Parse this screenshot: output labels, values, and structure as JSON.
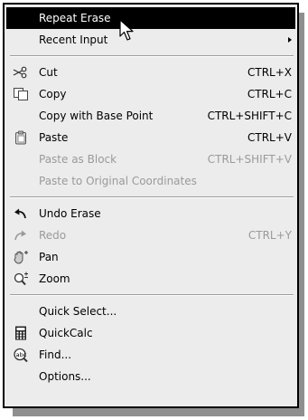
{
  "menu": {
    "items": [
      {
        "label": "Repeat Erase",
        "shortcut": "",
        "selected": true,
        "disabled": false,
        "icon": "",
        "submenu": false
      },
      {
        "label": "Recent Input",
        "shortcut": "",
        "selected": false,
        "disabled": false,
        "icon": "",
        "submenu": true
      },
      {
        "separator": true
      },
      {
        "label": "Cut",
        "shortcut": "CTRL+X",
        "selected": false,
        "disabled": false,
        "icon": "scissors-icon",
        "submenu": false
      },
      {
        "label": "Copy",
        "shortcut": "CTRL+C",
        "selected": false,
        "disabled": false,
        "icon": "copy-icon",
        "submenu": false
      },
      {
        "label": "Copy with Base Point",
        "shortcut": "CTRL+SHIFT+C",
        "selected": false,
        "disabled": false,
        "icon": "",
        "submenu": false
      },
      {
        "label": "Paste",
        "shortcut": "CTRL+V",
        "selected": false,
        "disabled": false,
        "icon": "paste-icon",
        "submenu": false
      },
      {
        "label": "Paste as Block",
        "shortcut": "CTRL+SHIFT+V",
        "selected": false,
        "disabled": true,
        "icon": "",
        "submenu": false
      },
      {
        "label": "Paste to Original Coordinates",
        "shortcut": "",
        "selected": false,
        "disabled": true,
        "icon": "",
        "submenu": false
      },
      {
        "separator": true
      },
      {
        "label": "Undo Erase",
        "shortcut": "",
        "selected": false,
        "disabled": false,
        "icon": "undo-icon",
        "submenu": false
      },
      {
        "label": "Redo",
        "shortcut": "CTRL+Y",
        "selected": false,
        "disabled": true,
        "icon": "redo-icon",
        "submenu": false
      },
      {
        "label": "Pan",
        "shortcut": "",
        "selected": false,
        "disabled": false,
        "icon": "pan-hand-icon",
        "submenu": false
      },
      {
        "label": "Zoom",
        "shortcut": "",
        "selected": false,
        "disabled": false,
        "icon": "zoom-icon",
        "submenu": false
      },
      {
        "separator": true
      },
      {
        "label": "Quick Select...",
        "shortcut": "",
        "selected": false,
        "disabled": false,
        "icon": "",
        "submenu": false
      },
      {
        "label": "QuickCalc",
        "shortcut": "",
        "selected": false,
        "disabled": false,
        "icon": "calculator-icon",
        "submenu": false
      },
      {
        "label": "Find...",
        "shortcut": "",
        "selected": false,
        "disabled": false,
        "icon": "find-text-icon",
        "submenu": false
      },
      {
        "label": "Options...",
        "shortcut": "",
        "selected": false,
        "disabled": false,
        "icon": "",
        "submenu": false
      }
    ]
  }
}
